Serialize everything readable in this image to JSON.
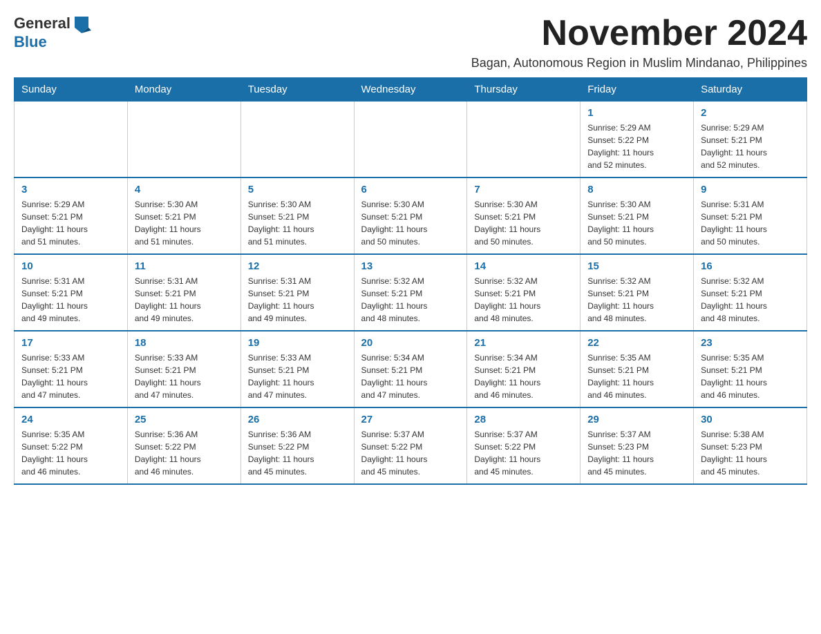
{
  "logo": {
    "general": "General",
    "blue": "Blue"
  },
  "title": "November 2024",
  "subtitle": "Bagan, Autonomous Region in Muslim Mindanao, Philippines",
  "days_header": [
    "Sunday",
    "Monday",
    "Tuesday",
    "Wednesday",
    "Thursday",
    "Friday",
    "Saturday"
  ],
  "weeks": [
    [
      {
        "day": "",
        "info": ""
      },
      {
        "day": "",
        "info": ""
      },
      {
        "day": "",
        "info": ""
      },
      {
        "day": "",
        "info": ""
      },
      {
        "day": "",
        "info": ""
      },
      {
        "day": "1",
        "info": "Sunrise: 5:29 AM\nSunset: 5:22 PM\nDaylight: 11 hours\nand 52 minutes."
      },
      {
        "day": "2",
        "info": "Sunrise: 5:29 AM\nSunset: 5:21 PM\nDaylight: 11 hours\nand 52 minutes."
      }
    ],
    [
      {
        "day": "3",
        "info": "Sunrise: 5:29 AM\nSunset: 5:21 PM\nDaylight: 11 hours\nand 51 minutes."
      },
      {
        "day": "4",
        "info": "Sunrise: 5:30 AM\nSunset: 5:21 PM\nDaylight: 11 hours\nand 51 minutes."
      },
      {
        "day": "5",
        "info": "Sunrise: 5:30 AM\nSunset: 5:21 PM\nDaylight: 11 hours\nand 51 minutes."
      },
      {
        "day": "6",
        "info": "Sunrise: 5:30 AM\nSunset: 5:21 PM\nDaylight: 11 hours\nand 50 minutes."
      },
      {
        "day": "7",
        "info": "Sunrise: 5:30 AM\nSunset: 5:21 PM\nDaylight: 11 hours\nand 50 minutes."
      },
      {
        "day": "8",
        "info": "Sunrise: 5:30 AM\nSunset: 5:21 PM\nDaylight: 11 hours\nand 50 minutes."
      },
      {
        "day": "9",
        "info": "Sunrise: 5:31 AM\nSunset: 5:21 PM\nDaylight: 11 hours\nand 50 minutes."
      }
    ],
    [
      {
        "day": "10",
        "info": "Sunrise: 5:31 AM\nSunset: 5:21 PM\nDaylight: 11 hours\nand 49 minutes."
      },
      {
        "day": "11",
        "info": "Sunrise: 5:31 AM\nSunset: 5:21 PM\nDaylight: 11 hours\nand 49 minutes."
      },
      {
        "day": "12",
        "info": "Sunrise: 5:31 AM\nSunset: 5:21 PM\nDaylight: 11 hours\nand 49 minutes."
      },
      {
        "day": "13",
        "info": "Sunrise: 5:32 AM\nSunset: 5:21 PM\nDaylight: 11 hours\nand 48 minutes."
      },
      {
        "day": "14",
        "info": "Sunrise: 5:32 AM\nSunset: 5:21 PM\nDaylight: 11 hours\nand 48 minutes."
      },
      {
        "day": "15",
        "info": "Sunrise: 5:32 AM\nSunset: 5:21 PM\nDaylight: 11 hours\nand 48 minutes."
      },
      {
        "day": "16",
        "info": "Sunrise: 5:32 AM\nSunset: 5:21 PM\nDaylight: 11 hours\nand 48 minutes."
      }
    ],
    [
      {
        "day": "17",
        "info": "Sunrise: 5:33 AM\nSunset: 5:21 PM\nDaylight: 11 hours\nand 47 minutes."
      },
      {
        "day": "18",
        "info": "Sunrise: 5:33 AM\nSunset: 5:21 PM\nDaylight: 11 hours\nand 47 minutes."
      },
      {
        "day": "19",
        "info": "Sunrise: 5:33 AM\nSunset: 5:21 PM\nDaylight: 11 hours\nand 47 minutes."
      },
      {
        "day": "20",
        "info": "Sunrise: 5:34 AM\nSunset: 5:21 PM\nDaylight: 11 hours\nand 47 minutes."
      },
      {
        "day": "21",
        "info": "Sunrise: 5:34 AM\nSunset: 5:21 PM\nDaylight: 11 hours\nand 46 minutes."
      },
      {
        "day": "22",
        "info": "Sunrise: 5:35 AM\nSunset: 5:21 PM\nDaylight: 11 hours\nand 46 minutes."
      },
      {
        "day": "23",
        "info": "Sunrise: 5:35 AM\nSunset: 5:21 PM\nDaylight: 11 hours\nand 46 minutes."
      }
    ],
    [
      {
        "day": "24",
        "info": "Sunrise: 5:35 AM\nSunset: 5:22 PM\nDaylight: 11 hours\nand 46 minutes."
      },
      {
        "day": "25",
        "info": "Sunrise: 5:36 AM\nSunset: 5:22 PM\nDaylight: 11 hours\nand 46 minutes."
      },
      {
        "day": "26",
        "info": "Sunrise: 5:36 AM\nSunset: 5:22 PM\nDaylight: 11 hours\nand 45 minutes."
      },
      {
        "day": "27",
        "info": "Sunrise: 5:37 AM\nSunset: 5:22 PM\nDaylight: 11 hours\nand 45 minutes."
      },
      {
        "day": "28",
        "info": "Sunrise: 5:37 AM\nSunset: 5:22 PM\nDaylight: 11 hours\nand 45 minutes."
      },
      {
        "day": "29",
        "info": "Sunrise: 5:37 AM\nSunset: 5:23 PM\nDaylight: 11 hours\nand 45 minutes."
      },
      {
        "day": "30",
        "info": "Sunrise: 5:38 AM\nSunset: 5:23 PM\nDaylight: 11 hours\nand 45 minutes."
      }
    ]
  ],
  "accent_color": "#1a6fa8"
}
